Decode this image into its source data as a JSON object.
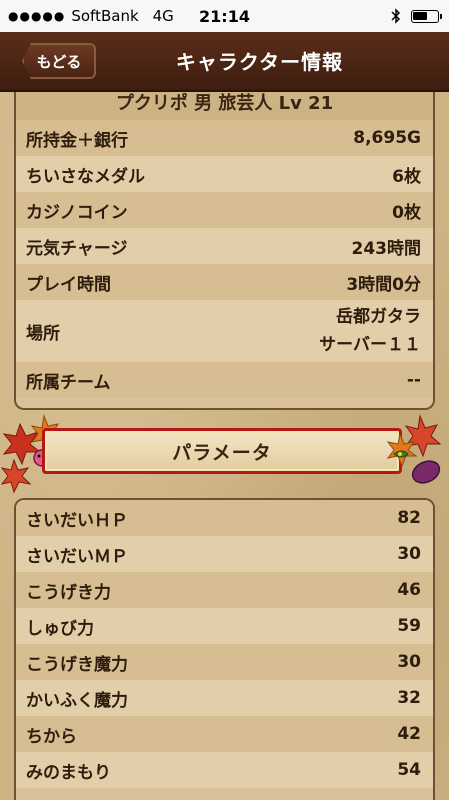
{
  "status_bar": {
    "carrier": "SoftBank",
    "network": "4G",
    "time": "21:14",
    "signal_dots": "●●●●●",
    "battery_level": 0.65
  },
  "header": {
    "back_label": "もどる",
    "title": "キャラクター情報"
  },
  "character": {
    "heading": "プクリポ 男 旅芸人 Lv 21",
    "rows": [
      {
        "label": "所持金＋銀行",
        "value": "8,695G"
      },
      {
        "label": "ちいさなメダル",
        "value": "6枚"
      },
      {
        "label": "カジノコイン",
        "value": "0枚"
      },
      {
        "label": "元気チャージ",
        "value": "243時間"
      },
      {
        "label": "プレイ時間",
        "value": "3時間0分"
      },
      {
        "label": "場所",
        "value_line1": "岳都ガタラ",
        "value_line2": "サーバー１１"
      },
      {
        "label": "所属チーム",
        "value": "--"
      }
    ]
  },
  "params_banner": "パラメータ",
  "params": [
    {
      "label": "さいだいＨＰ",
      "value": "82"
    },
    {
      "label": "さいだいＭＰ",
      "value": "30"
    },
    {
      "label": "こうげき力",
      "value": "46"
    },
    {
      "label": "しゅび力",
      "value": "59"
    },
    {
      "label": "こうげき魔力",
      "value": "30"
    },
    {
      "label": "かいふく魔力",
      "value": "32"
    },
    {
      "label": "ちから",
      "value": "42"
    },
    {
      "label": "みのまもり",
      "value": "54"
    }
  ]
}
